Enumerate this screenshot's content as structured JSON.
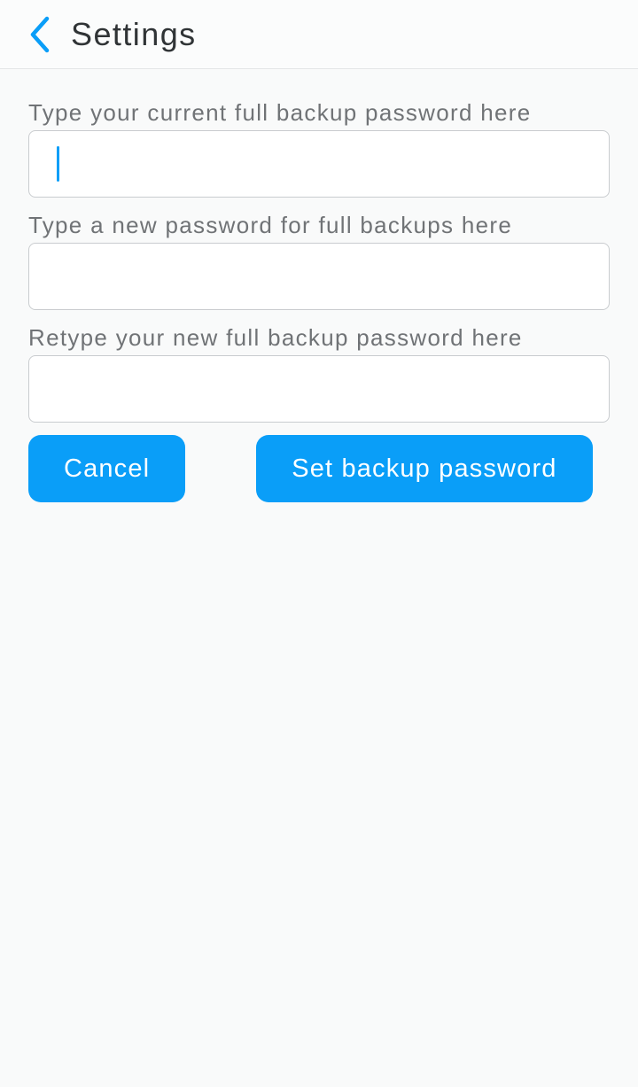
{
  "header": {
    "title": "Settings",
    "back_icon": "chevron-left"
  },
  "form": {
    "current_password": {
      "label": "Type your current full backup password here",
      "value": "",
      "focused": true
    },
    "new_password": {
      "label": "Type a new password for full backups here",
      "value": ""
    },
    "confirm_password": {
      "label": "Retype your new full backup password here",
      "value": ""
    }
  },
  "buttons": {
    "cancel_label": "Cancel",
    "submit_label": "Set backup password"
  },
  "colors": {
    "accent": "#0a9ef8",
    "text_primary": "#303436",
    "text_secondary": "#707376",
    "background": "#f9fafa",
    "input_border": "#c9cccf"
  }
}
